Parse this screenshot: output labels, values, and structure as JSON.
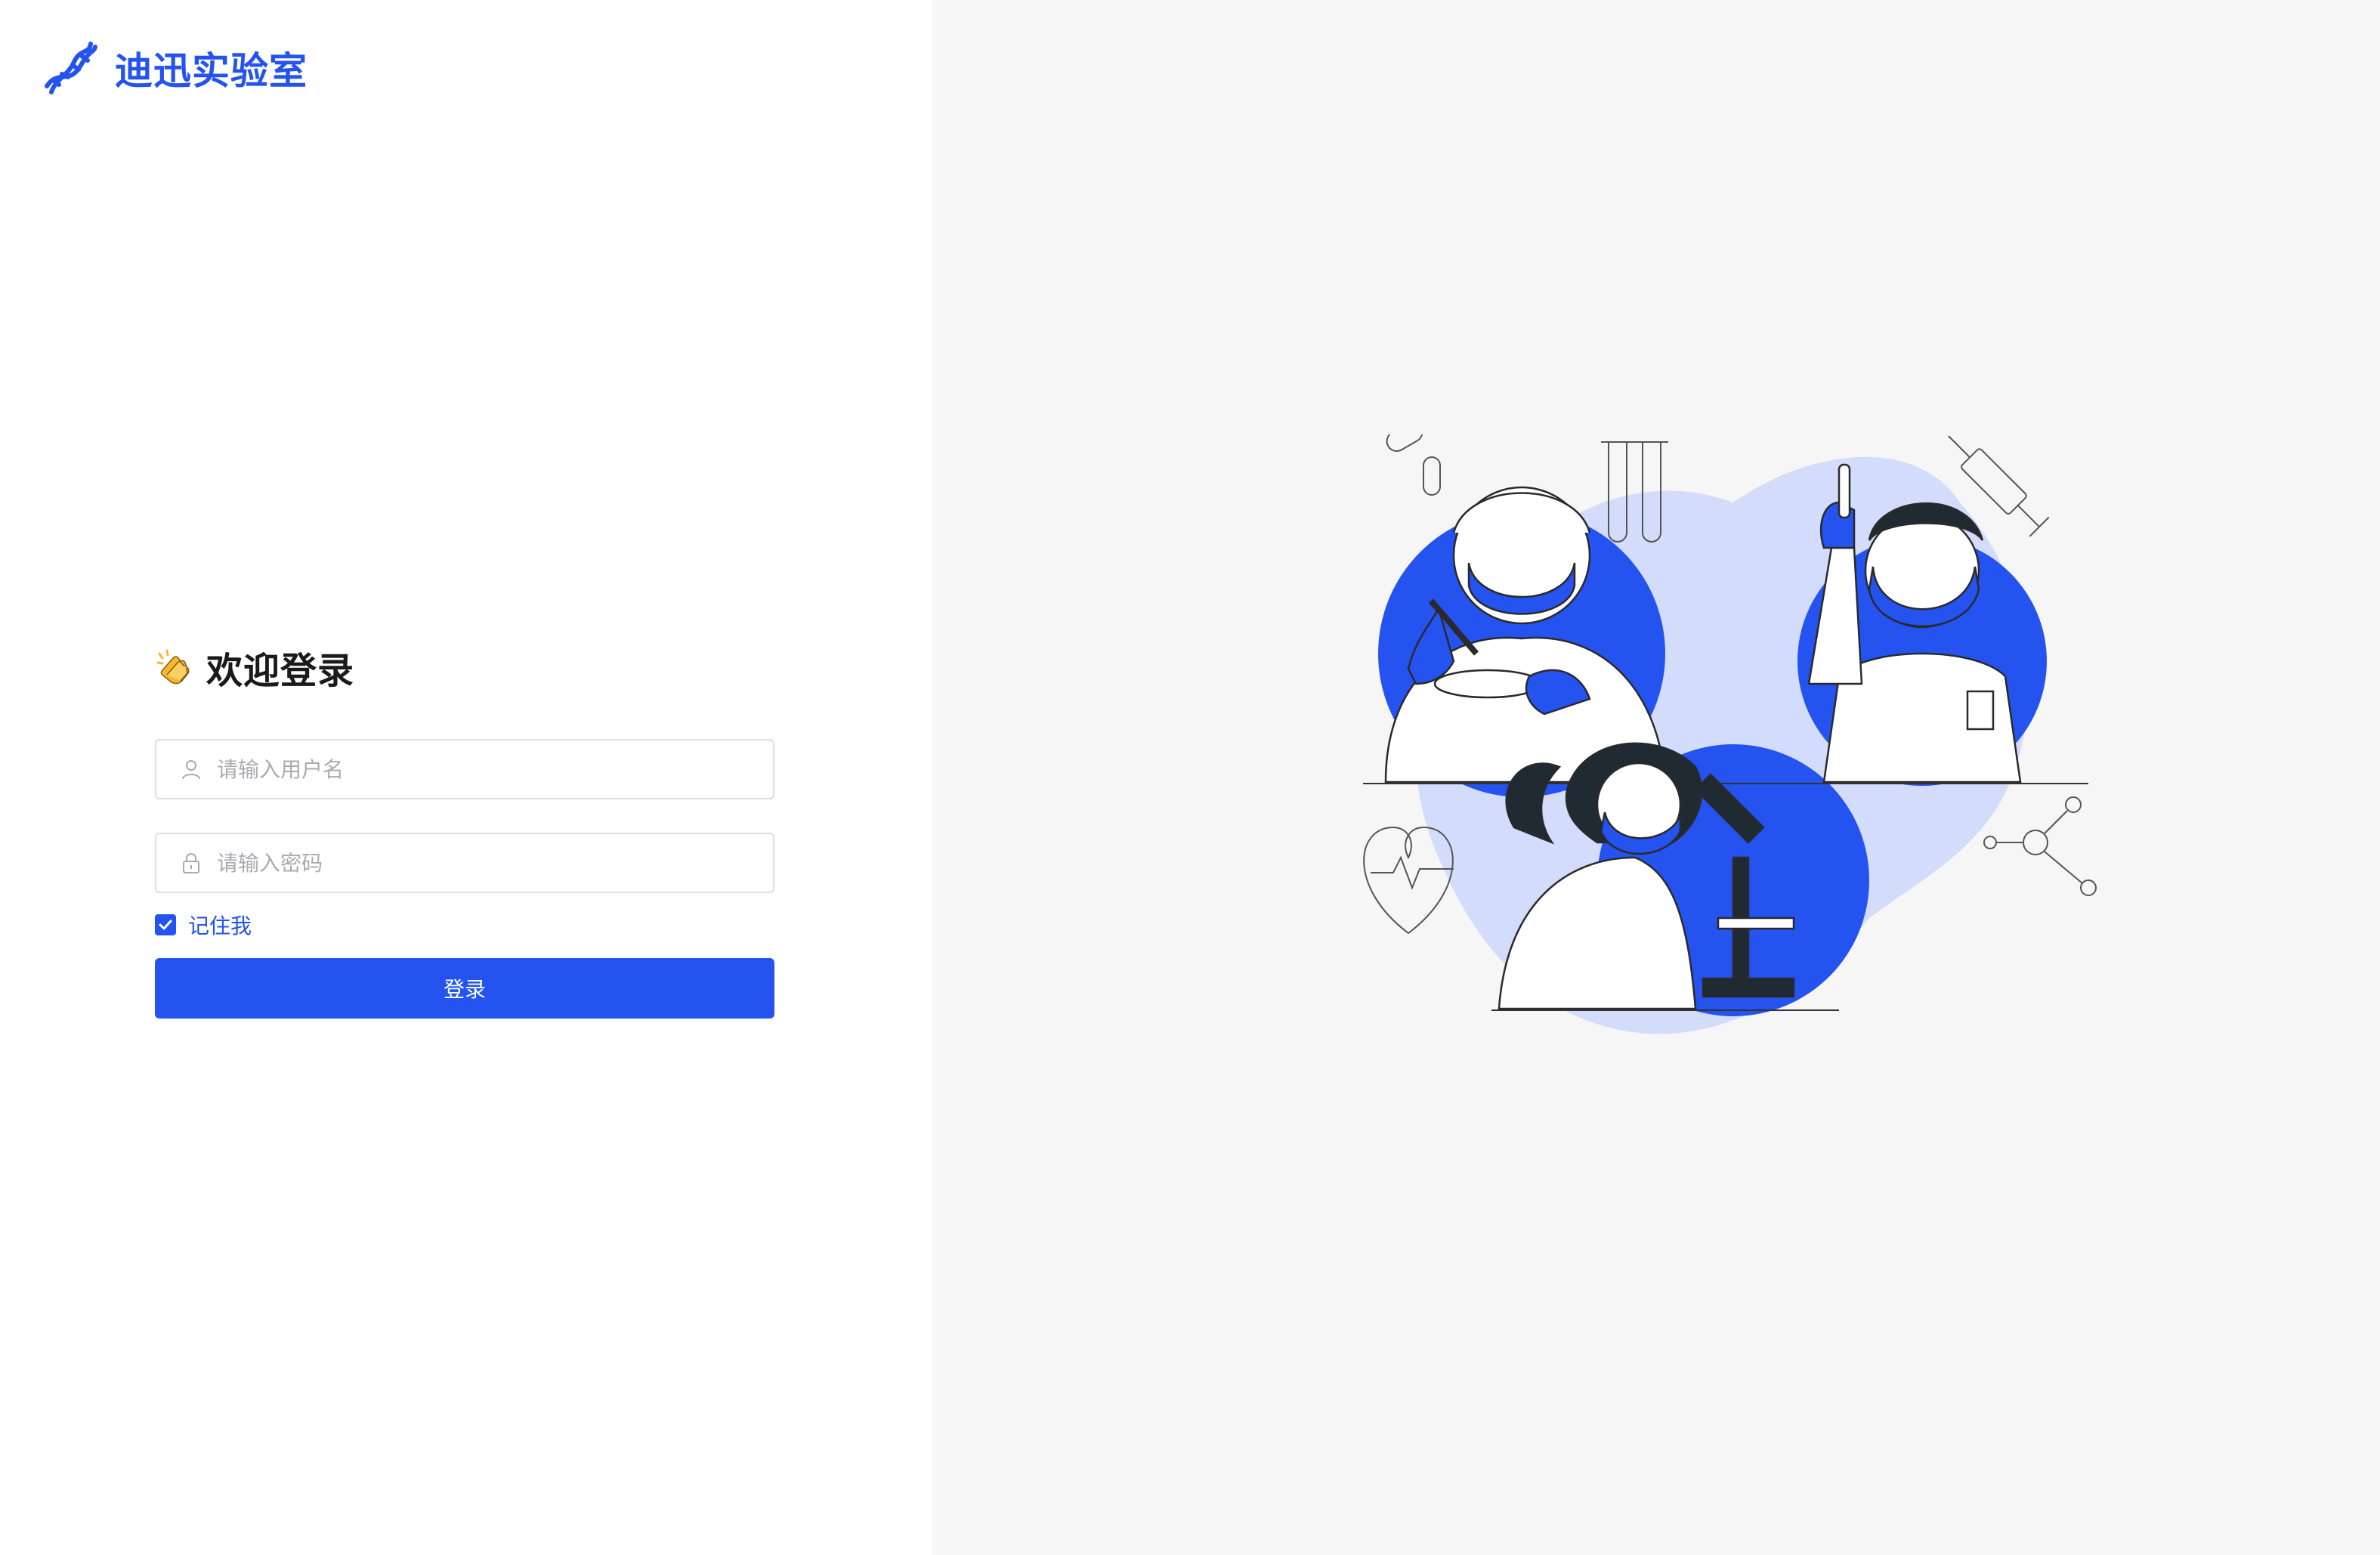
{
  "brand": {
    "name": "迪迅实验室",
    "logo_icon": "dna-helix-icon",
    "accent_color": "#2453f0"
  },
  "login": {
    "emoji_icon": "clapping-hands-icon",
    "title": "欢迎登录",
    "username": {
      "icon": "user-icon",
      "placeholder": "请输入用户名",
      "value": ""
    },
    "password": {
      "icon": "lock-icon",
      "placeholder": "请输入密码",
      "value": ""
    },
    "remember": {
      "label": "记住我",
      "checked": true
    },
    "submit_label": "登录"
  },
  "illustration": {
    "description_icon": "lab-scientists-illustration",
    "primary_color": "#2453f0",
    "blob_color": "#d4dcfb"
  }
}
